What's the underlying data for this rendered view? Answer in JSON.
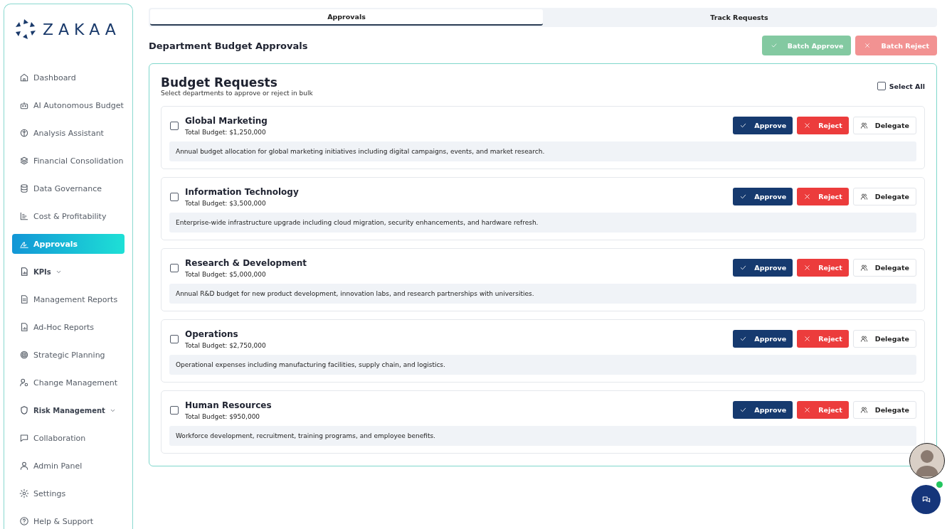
{
  "sidebar": {
    "logo": "ZAKAA",
    "items": [
      {
        "label": "Dashboard",
        "selected": false
      },
      {
        "label": "AI Autonomous Budget",
        "selected": false
      },
      {
        "label": "Analysis Assistant",
        "selected": false
      },
      {
        "label": "Financial Consolidation",
        "selected": false
      },
      {
        "label": "Data Governance",
        "selected": false
      },
      {
        "label": "Cost & Profitability",
        "selected": false
      },
      {
        "label": "Approvals",
        "selected": true
      },
      {
        "label": "KPIs",
        "selected": false,
        "expandable": true
      },
      {
        "label": "Management Reports",
        "selected": false
      },
      {
        "label": "Ad-Hoc Reports",
        "selected": false
      },
      {
        "label": "Strategic Planning",
        "selected": false
      },
      {
        "label": "Change Management",
        "selected": false
      },
      {
        "label": "Risk Management",
        "selected": false,
        "expandable": true
      },
      {
        "label": "Collaboration",
        "selected": false
      },
      {
        "label": "Admin Panel",
        "selected": false
      },
      {
        "label": "Settings",
        "selected": false
      },
      {
        "label": "Help & Support",
        "selected": false
      }
    ]
  },
  "tabs": [
    {
      "label": "Approvals",
      "selected": true
    },
    {
      "label": "Track Requests",
      "selected": false
    }
  ],
  "page_title": "Department Budget Approvals",
  "batch_buttons": [
    {
      "kind": "approve",
      "label": "Batch Approve",
      "disabled": true
    },
    {
      "kind": "reject",
      "label": "Batch Reject",
      "disabled": true
    }
  ],
  "panel": {
    "title": "Budget Requests",
    "subtitle": "Select departments to approve or reject in bulk",
    "select_all": {
      "label": "Select All",
      "checked": false
    }
  },
  "requests": [
    {
      "name": "Global Marketing",
      "budget": "Total Budget: $1,250,000",
      "checked": false,
      "description": "Annual budget allocation for global marketing initiatives including digital campaigns, events, and market research.",
      "actions": [
        "Approve",
        "Reject",
        "Delegate"
      ]
    },
    {
      "name": "Information Technology",
      "budget": "Total Budget: $3,500,000",
      "checked": false,
      "description": "Enterprise-wide infrastructure upgrade including cloud migration, security enhancements, and hardware refresh.",
      "actions": [
        "Approve",
        "Reject",
        "Delegate"
      ]
    },
    {
      "name": "Research & Development",
      "budget": "Total Budget: $5,000,000",
      "checked": false,
      "description": "Annual R&D budget for new product development, innovation labs, and research partnerships with universities.",
      "actions": [
        "Approve",
        "Reject",
        "Delegate"
      ]
    },
    {
      "name": "Operations",
      "budget": "Total Budget: $2,750,000",
      "checked": false,
      "description": "Operational expenses including manufacturing facilities, supply chain, and logistics.",
      "actions": [
        "Approve",
        "Reject",
        "Delegate"
      ]
    },
    {
      "name": "Human Resources",
      "budget": "Total Budget: $950,000",
      "checked": false,
      "description": "Workforce development, recruitment, training programs, and employee benefits.",
      "actions": [
        "Approve",
        "Reject",
        "Delegate"
      ]
    }
  ],
  "assistant": {
    "online": true
  }
}
